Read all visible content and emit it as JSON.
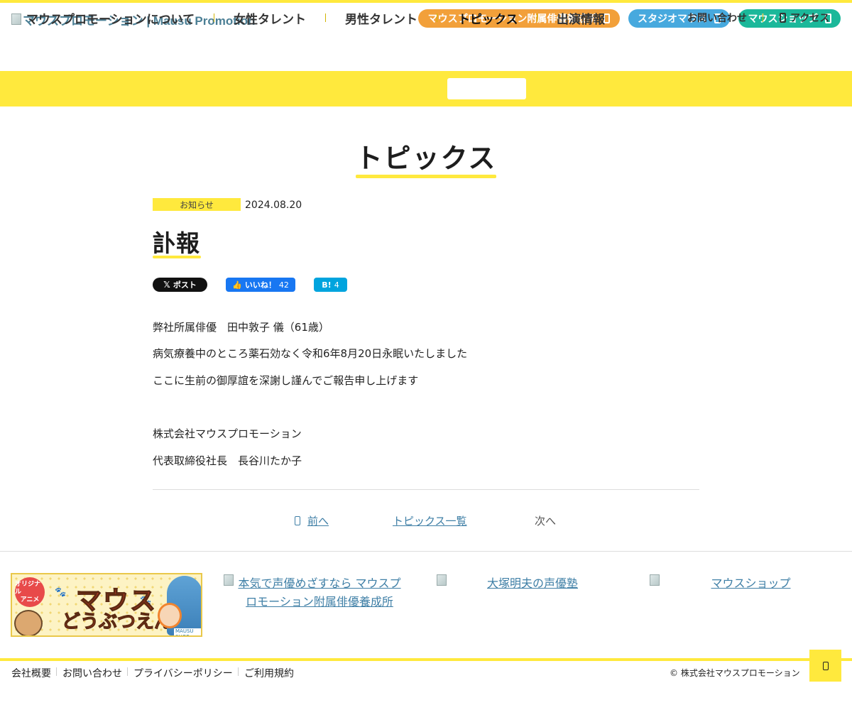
{
  "header": {
    "logo_alt": "マウスプロモーション | Mausu Promotion",
    "pills": [
      {
        "label": "マウスプロモーション附属俳優養成所",
        "color": "#f2a03a"
      },
      {
        "label": "スタジオマウス",
        "color": "#47a9de"
      },
      {
        "label": "マウスショップ",
        "color": "#1bb89a"
      }
    ]
  },
  "nav": {
    "items": [
      "マウスプロモーションについて",
      "女性タレント",
      "男性タレント",
      "トピックス",
      "出演情報"
    ],
    "active": "トピックス",
    "contact": "お問い合わせ",
    "access": "アクセス",
    "accent": "#ffe93d"
  },
  "page": {
    "title": "トピックス"
  },
  "post": {
    "category": "お知らせ",
    "date": "2024.08.20",
    "title": "訃報",
    "share": {
      "x_label": "ポスト",
      "fb_label": "いいね！",
      "fb_count": "42",
      "hb_label": "B!",
      "hb_count": "4"
    },
    "body": [
      "弊社所属俳優　田中敦子 儀（61歳）",
      "病気療養中のところ薬石効なく令和6年8月20日永眠いたしました",
      "ここに生前の御厚誼を深謝し謹んでご報告申し上げます",
      "株式会社マウスプロモーション",
      "代表取締役社長　長谷川たか子"
    ]
  },
  "pager": {
    "prev": "前へ",
    "list": "トピックス一覧",
    "next": "次へ"
  },
  "footer": {
    "banner": {
      "badge_line1": "オリジナル",
      "badge_line2": "アニメ",
      "title1": "マウス",
      "title2": "どうぶつえん",
      "shop_tag": "MAUSU SHOP"
    },
    "links": [
      "本気で声優めざすなら マウスプロモーション附属俳優養成所",
      "大塚明夫の声優塾",
      "マウスショップ"
    ],
    "nav": [
      "会社概要",
      "お問い合わせ",
      "プライバシーポリシー",
      "ご利用規約"
    ],
    "copyright": "© 株式会社マウスプロモーション"
  }
}
